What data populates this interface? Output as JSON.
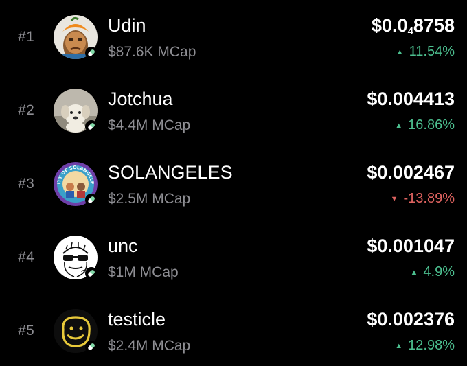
{
  "colors": {
    "background": "#000000",
    "positive": "#4cbf8f",
    "negative": "#e06360",
    "muted": "#8e8e93",
    "pill_green": "#7fd9a6",
    "pill_white": "#ffffff"
  },
  "tokens": [
    {
      "rank": "#1",
      "name": "Udin",
      "mcap": "$87.6K MCap",
      "price_prefix": "$0.0",
      "price_sub": "4",
      "price_rest": "8758",
      "change": "11.54%",
      "direction": "up",
      "avatar_icon": "orange-hat-character-avatar"
    },
    {
      "rank": "#2",
      "name": "Jotchua",
      "mcap": "$4.4M MCap",
      "price": "$0.004413",
      "change": "16.86%",
      "direction": "up",
      "avatar_icon": "white-puppy-avatar"
    },
    {
      "rank": "#3",
      "name": "SOLANGELES",
      "mcap": "$2.5M MCap",
      "price": "$0.002467",
      "change": "-13.89%",
      "direction": "down",
      "avatar_icon": "city-of-solangeles-badge-avatar",
      "avatar_text": "CITY OF SOLANGELES"
    },
    {
      "rank": "#4",
      "name": "unc",
      "mcap": "$1M MCap",
      "price": "$0.001047",
      "change": "4.9%",
      "direction": "up",
      "avatar_icon": "sunglasses-meme-face-avatar"
    },
    {
      "rank": "#5",
      "name": "testicle",
      "mcap": "$2.4M MCap",
      "price": "$0.002376",
      "change": "12.98%",
      "direction": "up",
      "avatar_icon": "yellow-smiley-doodle-avatar"
    }
  ]
}
